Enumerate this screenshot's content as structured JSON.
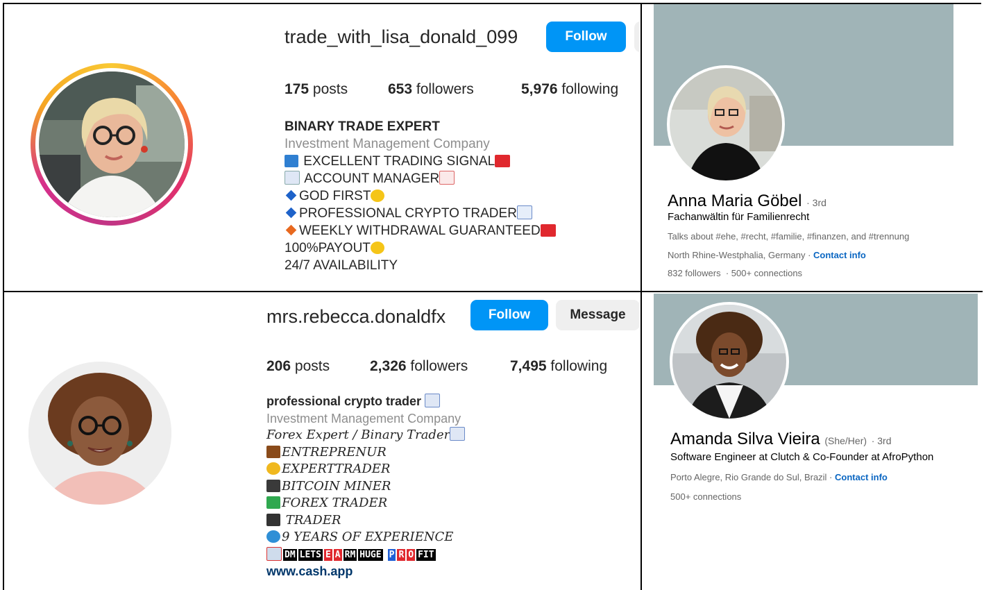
{
  "panel1": {
    "username": "trade_with_lisa_donald_099",
    "follow_label": "Follow",
    "stats": {
      "posts_num": "175",
      "posts_label": "posts",
      "followers_num": "653",
      "followers_label": "followers",
      "following_num": "5,976",
      "following_label": "following"
    },
    "bio": {
      "name": "BINARY TRADE EXPERT",
      "category": "Investment Management Company",
      "lines": [
        "EXCELLENT TRADING SIGNAL",
        "ACCOUNT MANAGER",
        "GOD FIRST",
        "PROFESSIONAL CRYPTO TRADER",
        "WEEKLY WITHDRAWAL GUARANTEED",
        "100%PAYOUT",
        "24/7 AVAILABILITY"
      ]
    }
  },
  "panel2": {
    "name": "Anna Maria Göbel",
    "degree": "· 3rd",
    "headline": "Fachanwältin für Familienrecht",
    "talks": "Talks about #ehe, #recht, #familie, #finanzen, and #trennung",
    "location": "North Rhine-Westphalia, Germany ·",
    "contact": "Contact info",
    "followers": "832 followers",
    "connections": "· 500+ connections"
  },
  "panel3": {
    "username": "mrs.rebecca.donaldfx",
    "follow_label": "Follow",
    "message_label": "Message",
    "stats": {
      "posts_num": "206",
      "posts_label": "posts",
      "followers_num": "2,326",
      "followers_label": "followers",
      "following_num": "7,495",
      "following_label": "following"
    },
    "bio": {
      "name": "professional crypto trader",
      "category": "Investment Management Company",
      "lines": [
        "Forex Expert / Binary Trader",
        "ENTREPRENUR",
        "EXPERTTRADER",
        "BITCOIN MINER",
        "FOREX TRADER",
        " TRADER",
        "9 YEARS OF EXPERIENCE"
      ],
      "boxed": [
        "DM",
        "LETS",
        "E",
        "A",
        "RM",
        "HUGE",
        "P",
        "R",
        "O",
        "FIT"
      ],
      "link": "www.cash.app"
    }
  },
  "panel4": {
    "name": "Amanda Silva Vieira",
    "pronouns": "(She/Her)",
    "degree": "· 3rd",
    "headline": "Software Engineer at Clutch & Co-Founder at AfroPython",
    "location": "Porto Alegre, Rio Grande do Sul, Brazil ·",
    "contact": "Contact info",
    "connections": "500+ connections"
  },
  "colors": {
    "instagram_blue": "#0095f6",
    "linkedin_blue": "#0a66c2",
    "banner": "#a0b4b7"
  }
}
